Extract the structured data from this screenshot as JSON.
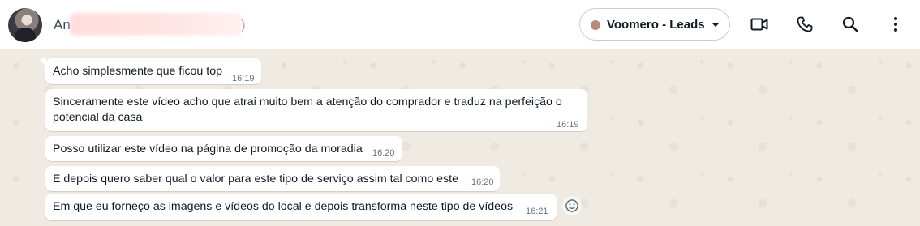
{
  "header": {
    "contact_name_prefix": "An",
    "contact_name_suffix": ")",
    "label": {
      "text": "Voomero - Leads",
      "color": "#b58c7c"
    },
    "icons": [
      "video-call-icon",
      "phone-icon",
      "search-icon",
      "more-vert-icon"
    ]
  },
  "messages": [
    {
      "text": "Acho simplesmente que ficou top",
      "time": "16:19"
    },
    {
      "text": "Sinceramente este vídeo acho que atrai muito bem a atenção do comprador e traduz na perfeição o potencial da casa",
      "time": "16:19"
    },
    {
      "text": "Posso utilizar este vídeo na página de promoção da moradia",
      "time": "16:20"
    },
    {
      "text": "E depois quero saber qual o valor para este tipo de serviço assim tal como este",
      "time": "16:20"
    },
    {
      "text": "Em que eu forneço as imagens e vídeos do local e depois transforma neste tipo de vídeos",
      "time": "16:21"
    }
  ],
  "colors": {
    "chat_background": "#efeae2",
    "bubble_incoming": "#ffffff",
    "text_primary": "#111b21",
    "text_secondary": "#667781"
  }
}
